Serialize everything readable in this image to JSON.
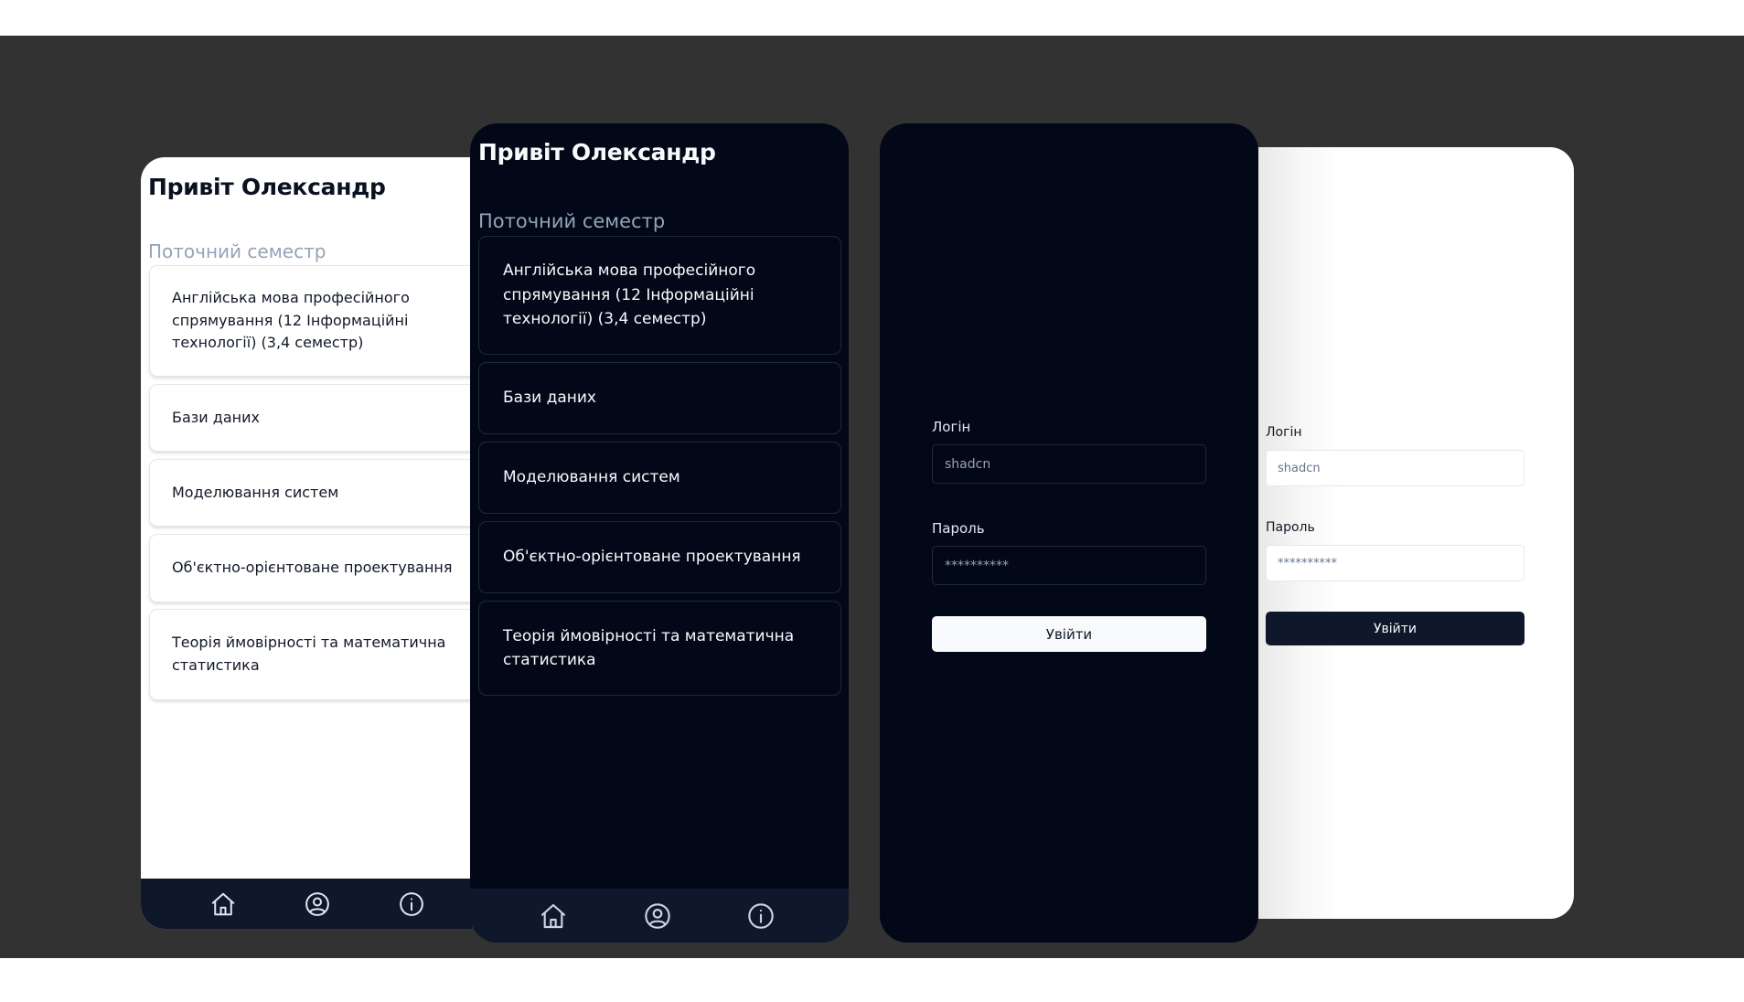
{
  "screens": {
    "light_courses": {
      "greeting": "Привіт Олександр",
      "section_title": "Поточний семестр",
      "courses": [
        {
          "name": "Англійська мова професійного спрямування (12 Інформаційні технології) (3,4 семестр)"
        },
        {
          "name": "Бази даних"
        },
        {
          "name": "Моделювання систем"
        },
        {
          "name": "Об'єктно-орієнтоване проектування"
        },
        {
          "name": "Теорія ймовірності та математична статистика"
        }
      ],
      "nav": [
        "home-icon",
        "user-circle-icon",
        "info-icon"
      ]
    },
    "dark_courses": {
      "greeting": "Привіт Олександр",
      "section_title": "Поточний семестр",
      "courses": [
        {
          "name": "Англійська мова професійного спрямування (12 Інформаційні технології) (3,4 семестр)"
        },
        {
          "name": "Бази даних"
        },
        {
          "name": "Моделювання систем"
        },
        {
          "name": "Об'єктно-орієнтоване проектування"
        },
        {
          "name": "Теорія ймовірності та математична статистика"
        }
      ],
      "nav": [
        "home-icon",
        "user-circle-icon",
        "info-icon"
      ]
    },
    "dark_login": {
      "login_label": "Логін",
      "login_value": "shadcn",
      "password_label": "Пароль",
      "password_value": "**********",
      "submit_label": "Увійти"
    },
    "light_login": {
      "login_label": "Логін",
      "login_value": "shadcn",
      "password_label": "Пароль",
      "password_value": "**********",
      "submit_label": "Увійти"
    }
  },
  "colors": {
    "backdrop": "#323232",
    "dark_bg": "#020817",
    "nav_bg": "#0f172a",
    "muted_text": "#94a3b8"
  }
}
